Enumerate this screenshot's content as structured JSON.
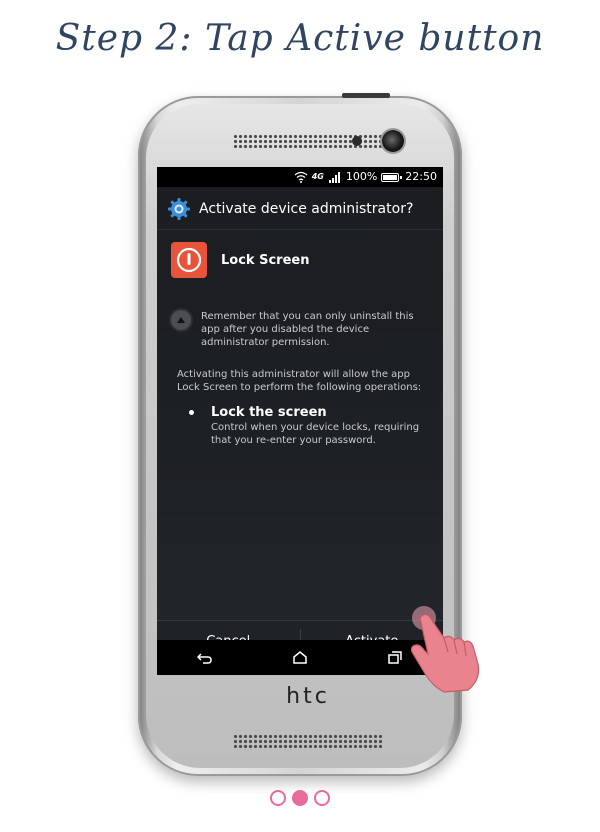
{
  "step_title": "Step 2: Tap Active button",
  "phone_brand": "htc",
  "statusbar": {
    "network": "4G",
    "battery": "100%",
    "time": "22:50"
  },
  "dialog": {
    "title": "Activate device administrator?",
    "app_name": "Lock Screen",
    "info_text": "Remember that you can only uninstall this app after you disabled the device administrator permission.",
    "description": "Activating this administrator will allow the app Lock Screen to perform the following operations:",
    "operation": {
      "title": "Lock the screen",
      "description": "Control when your device locks, requiring that you re-enter your password."
    },
    "cancel_label": "Cancel",
    "activate_label": "Activate"
  },
  "pagination": {
    "total": 3,
    "current": 2
  },
  "colors": {
    "title": "#2f4560",
    "accent_pink": "#e86b9c",
    "app_icon": "#e8543a",
    "dialog_bg": "#1d2024"
  },
  "icons": {
    "gear": "settings-gear-icon",
    "app": "power-icon",
    "info": "up-arrow-icon",
    "back": "back-icon",
    "home": "home-icon",
    "recents": "recents-icon",
    "hand": "tap-hand-icon"
  }
}
